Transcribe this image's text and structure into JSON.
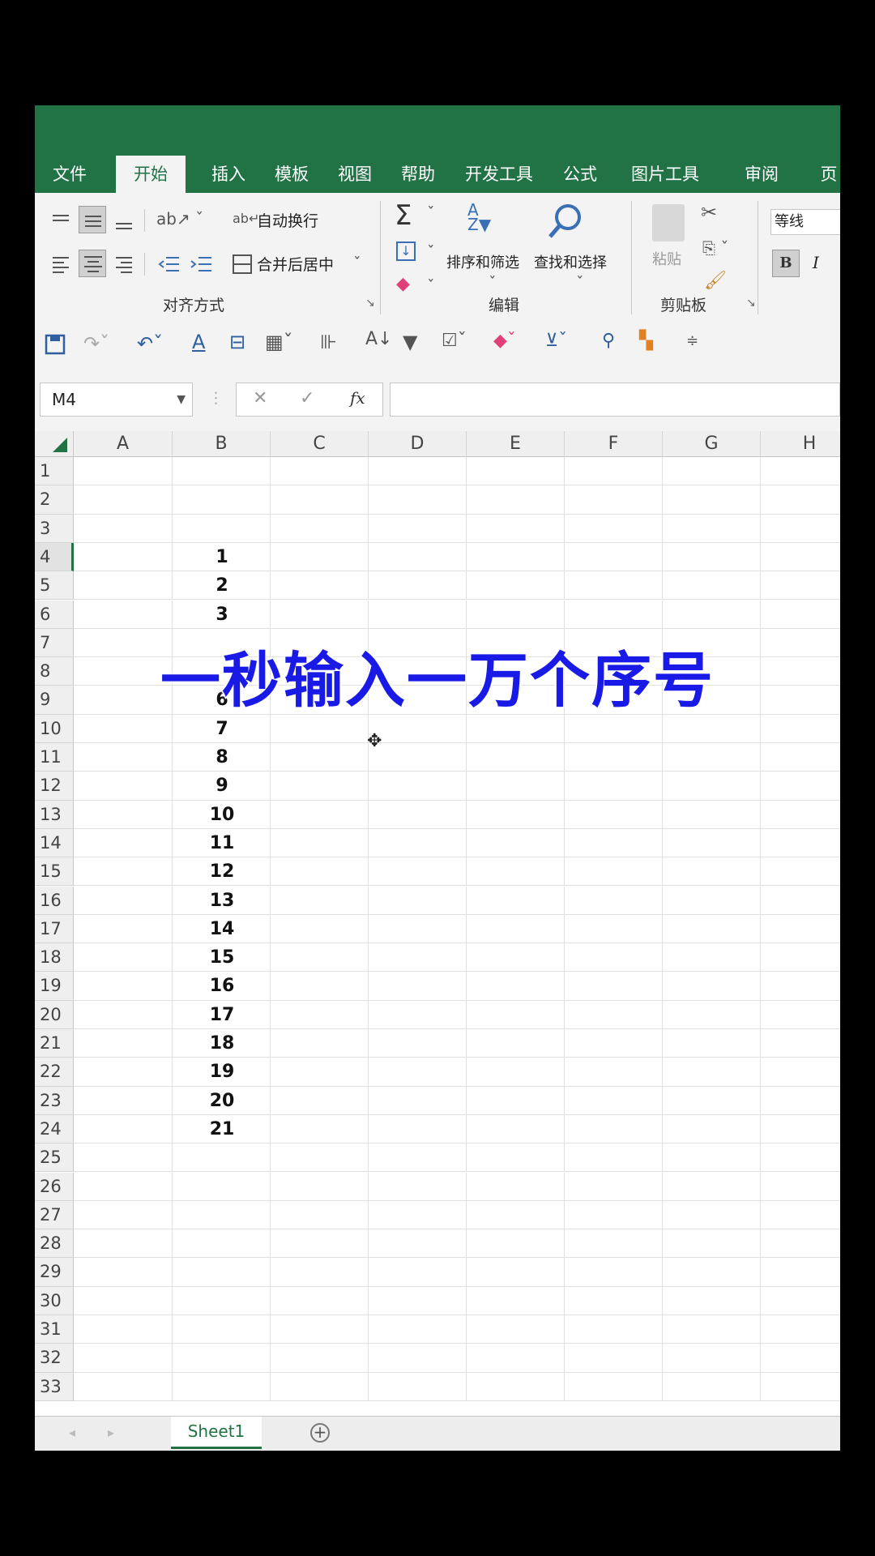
{
  "ribbon_tabs": [
    "文件",
    "开始",
    "插入",
    "模板",
    "视图",
    "帮助",
    "开发工具",
    "公式",
    "图片工具",
    "审阅",
    "页"
  ],
  "active_tab": "开始",
  "alignment": {
    "wrap_text": "自动换行",
    "merge_center": "合并后居中",
    "group_label": "对齐方式"
  },
  "editing": {
    "sort_filter": "排序和筛选",
    "find_select": "查找和选择",
    "group_label": "编辑"
  },
  "clipboard": {
    "paste": "粘贴",
    "group_label": "剪贴板"
  },
  "font": {
    "name": "等线",
    "bold": "B",
    "italic": "I"
  },
  "formula_bar": {
    "name_box": "M4",
    "fx": "fx",
    "value": ""
  },
  "columns": [
    "A",
    "B",
    "C",
    "D",
    "E",
    "F",
    "G",
    "H"
  ],
  "rows": [
    "1",
    "2",
    "3",
    "4",
    "5",
    "6",
    "7",
    "8",
    "9",
    "10",
    "11",
    "12",
    "13",
    "14",
    "15",
    "16",
    "17",
    "18",
    "19",
    "20",
    "21",
    "22",
    "23",
    "24",
    "25",
    "26",
    "27",
    "28",
    "29",
    "30",
    "31",
    "32",
    "33"
  ],
  "column_b_values": [
    {
      "row": 4,
      "value": "1"
    },
    {
      "row": 5,
      "value": "2"
    },
    {
      "row": 6,
      "value": "3"
    },
    {
      "row": 9,
      "value": "6"
    },
    {
      "row": 10,
      "value": "7"
    },
    {
      "row": 11,
      "value": "8"
    },
    {
      "row": 12,
      "value": "9"
    },
    {
      "row": 13,
      "value": "10"
    },
    {
      "row": 14,
      "value": "11"
    },
    {
      "row": 15,
      "value": "12"
    },
    {
      "row": 16,
      "value": "13"
    },
    {
      "row": 17,
      "value": "14"
    },
    {
      "row": 18,
      "value": "15"
    },
    {
      "row": 19,
      "value": "16"
    },
    {
      "row": 20,
      "value": "17"
    },
    {
      "row": 21,
      "value": "18"
    },
    {
      "row": 22,
      "value": "19"
    },
    {
      "row": 23,
      "value": "20"
    },
    {
      "row": 24,
      "value": "21"
    }
  ],
  "sheet_tab": "Sheet1",
  "overlay_caption": "一秒输入一万个序号",
  "colors": {
    "accent": "#217346",
    "caption": "#1a1ae6"
  }
}
